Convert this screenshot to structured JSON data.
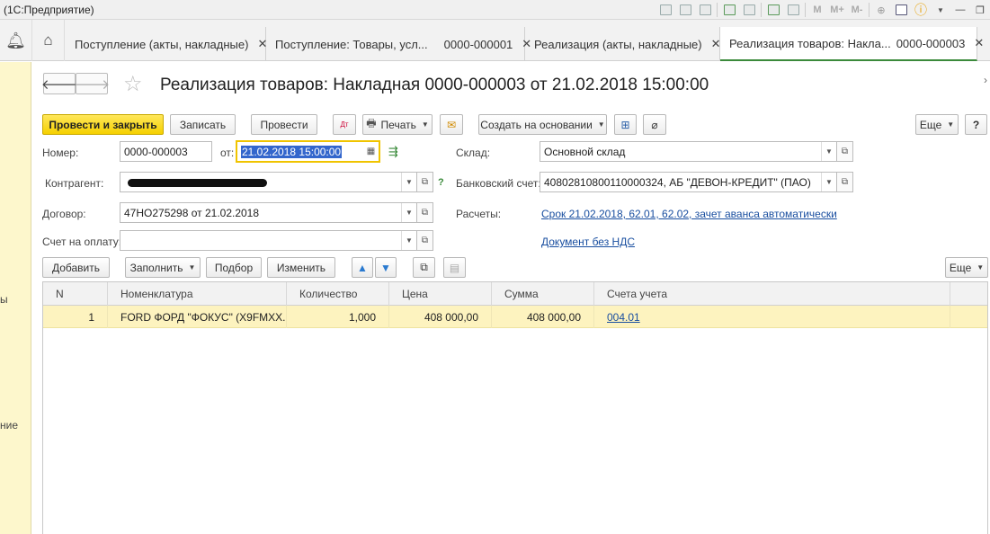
{
  "app": {
    "title": "(1С:Предприятие)"
  },
  "tabs": [
    {
      "label": "Поступление (акты, накладные)"
    },
    {
      "label": "Поступление: Товары, усл...",
      "number": "0000-000001"
    },
    {
      "label": "Реализация (акты, накладные)"
    },
    {
      "label": "Реализация товаров: Накла...",
      "number": "0000-000003"
    }
  ],
  "sidebar": {
    "fragments": [
      "ы",
      "ние"
    ]
  },
  "document": {
    "title": "Реализация товаров: Накладная 0000-000003 от 21.02.2018 15:00:00"
  },
  "toolbar": {
    "post_close": "Провести и закрыть",
    "save": "Записать",
    "post": "Провести",
    "print": "Печать",
    "create_based": "Создать на основании",
    "more": "Еще",
    "help": "?"
  },
  "form": {
    "number_label": "Номер:",
    "number_value": "0000-000003",
    "date_label": "от:",
    "date_value": "21.02.2018 15:00:00",
    "warehouse_label": "Склад:",
    "warehouse_value": "Основной склад",
    "counterparty_label": "Контрагент:",
    "bank_label": "Банковский счет:",
    "bank_value": "40802810800110000324, АБ \"ДЕВОН-КРЕДИТ\" (ПАО)",
    "contract_label": "Договор:",
    "contract_value": "47НО275298 от 21.02.2018",
    "settlements_label": "Расчеты:",
    "settlements_link": "Срок 21.02.2018, 62.01, 62.02, зачет аванса автоматически",
    "invoice_label": "Счет на оплату:",
    "invoice_value": "",
    "vat_link": "Документ без НДС"
  },
  "table_toolbar": {
    "add": "Добавить",
    "fill": "Заполнить",
    "pick": "Подбор",
    "change": "Изменить",
    "more": "Еще"
  },
  "table": {
    "columns": [
      "N",
      "Номенклатура",
      "Количество",
      "Цена",
      "Сумма",
      "Счета учета"
    ],
    "rows": [
      {
        "n": "1",
        "item": "FORD ФОРД \"ФОКУС\" (X9FMXX...",
        "qty": "1,000",
        "price": "408 000,00",
        "sum": "408 000,00",
        "account": "004.01"
      }
    ]
  }
}
